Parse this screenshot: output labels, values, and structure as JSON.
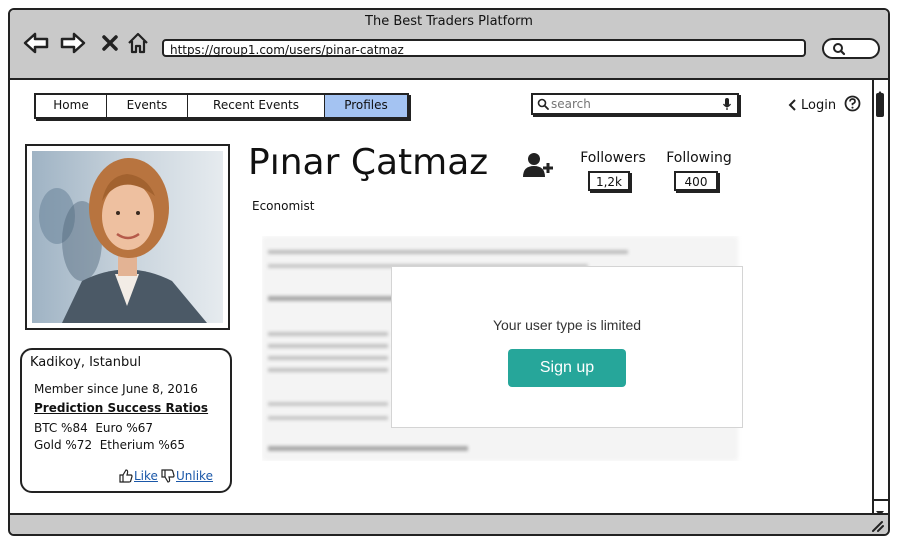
{
  "window": {
    "title": "The Best Traders Platform"
  },
  "browser": {
    "url": "https://group1.com/users/pinar-catmaz"
  },
  "nav": {
    "tabs": [
      {
        "label": "Home",
        "active": false
      },
      {
        "label": "Events",
        "active": false
      },
      {
        "label": "Recent Events",
        "active": false
      },
      {
        "label": "Profiles",
        "active": true
      }
    ],
    "search_placeholder": "search",
    "login_label": "Login"
  },
  "profile": {
    "name": "Pınar Çatmaz",
    "occupation": "Economist",
    "followers_label": "Followers",
    "followers_count": "1,2k",
    "following_label": "Following",
    "following_count": "400"
  },
  "info_card": {
    "location": "Kadikoy, Istanbul",
    "member_since": "Member since June 8, 2016",
    "ratios_heading": "Prediction Success Ratios",
    "ratios_line1": "BTC %84  Euro %67",
    "ratios_line2": "Gold %72  Etherium %65",
    "like_label": "Like",
    "unlike_label": "Unlike"
  },
  "modal": {
    "message": "Your user type is limited",
    "button_label": "Sign up"
  },
  "colors": {
    "chrome": "#c9c9c9",
    "active_tab": "#a4c3f2",
    "signup_button": "#26a69a",
    "link": "#1a57a8"
  }
}
